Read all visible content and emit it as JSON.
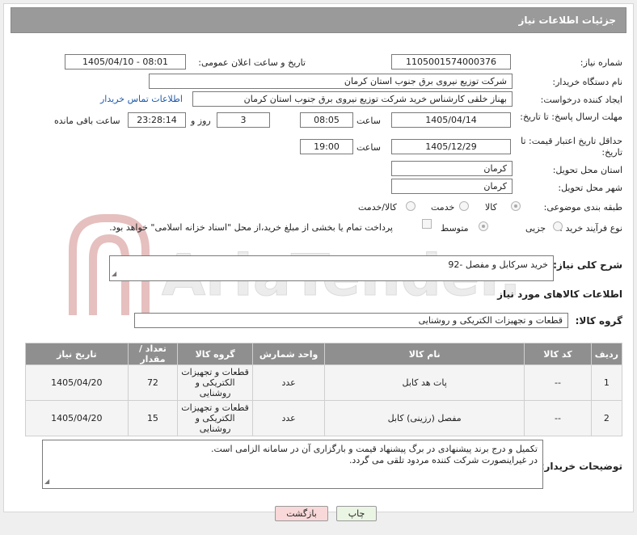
{
  "header": {
    "title": "جزئیات اطلاعات نیاز"
  },
  "labels": {
    "need_number": "شماره نیاز:",
    "announce_datetime": "تاریخ و ساعت اعلان عمومی:",
    "buyer_org": "نام دستگاه خریدار:",
    "creator": "ایجاد کننده درخواست:",
    "reply_deadline": "مهلت ارسال پاسخ: تا تاریخ:",
    "time": "ساعت",
    "day_and": "روز و",
    "remaining": "ساعت باقی مانده",
    "min_validity": "حداقل تاریخ اعتبار قیمت: تا تاریخ:",
    "province": "استان محل تحویل:",
    "city": "شهر محل تحویل:",
    "category": "طبقه بندی موضوعی:",
    "purchase_type": "نوع فرآیند خرید :",
    "need_desc": "شرح کلی نیاز:",
    "goods_info": "اطلاعات کالاهای مورد نیاز",
    "goods_group": "گروه کالا:",
    "buyer_notes": "توضیحات خریدار:"
  },
  "values": {
    "need_number": "1105001574000376",
    "announce_datetime": "1405/04/10 - 08:01",
    "buyer_org": "شرکت توزیع نیروی برق جنوب استان کرمان",
    "creator": "بهناز خلقی کارشناس خرید شرکت توزیع نیروی برق جنوب استان کرمان",
    "contact_link": "اطلاعات تماس خریدار",
    "reply_date": "1405/04/14",
    "reply_time": "08:05",
    "days": "3",
    "remaining_time": "23:28:14",
    "validity_date": "1405/12/29",
    "validity_time": "19:00",
    "province": "کرمان",
    "city": "کرمان",
    "need_desc": "خرید سرکابل و مفصل -92",
    "goods_group": "قطعات و تجهیزات الکتریکی و روشنایی",
    "buyer_notes_line1": "تکمیل و درج برند پیشنهادی در برگ پیشنهاد قیمت و بارگزاری آن در سامانه الزامی است.",
    "buyer_notes_line2": "در غیراینصورت شرکت کننده مردود تلقی می گردد."
  },
  "category_options": [
    {
      "label": "کالا",
      "selected": true
    },
    {
      "label": "خدمت",
      "selected": false
    },
    {
      "label": "کالا/خدمت",
      "selected": false
    }
  ],
  "purchase_options": [
    {
      "label": "جزیی",
      "selected": false
    },
    {
      "label": "متوسط",
      "selected": true
    }
  ],
  "payment_note": "پرداخت تمام یا بخشی از مبلغ خرید،از محل \"اسناد خزانه اسلامی\" خواهد بود.",
  "table": {
    "headers": [
      "ردیف",
      "کد کالا",
      "نام کالا",
      "واحد شمارش",
      "گروه کالا",
      "تعداد / مقدار",
      "تاریخ نیاز"
    ],
    "rows": [
      {
        "row": "1",
        "code": "--",
        "name": "پات هد کابل",
        "unit": "عدد",
        "group": "قطعات و تجهیزات الکتریکی و روشنایی",
        "qty": "72",
        "date": "1405/04/20"
      },
      {
        "row": "2",
        "code": "--",
        "name": "مفصل (رزینی) کابل",
        "unit": "عدد",
        "group": "قطعات و تجهیزات الکتریکی و روشنایی",
        "qty": "15",
        "date": "1405/04/20"
      }
    ]
  },
  "buttons": {
    "print": "چاپ",
    "back": "بازگشت"
  },
  "watermark": {
    "text": "AriaTender.net"
  },
  "colors": {
    "title_bar": "#9a9a9a",
    "table_header": "#8f8f8f",
    "link": "#1e5aa8",
    "back_button": "#f8d8d8",
    "print_button": "#eaf5e4"
  }
}
